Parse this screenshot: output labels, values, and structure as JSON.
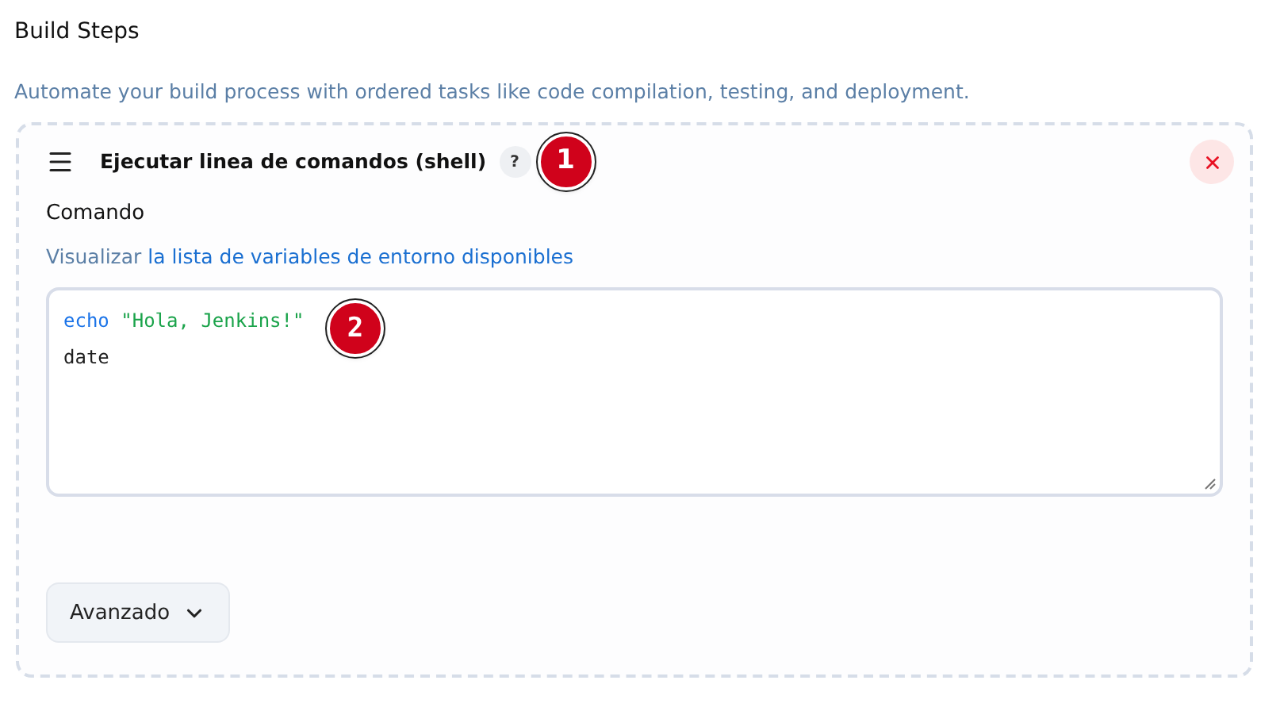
{
  "section": {
    "title": "Build Steps",
    "description": "Automate your build process with ordered tasks like code compilation, testing, and deployment."
  },
  "step": {
    "title": "Ejecutar linea de comandos (shell)",
    "help": "?",
    "field_label": "Comando",
    "link_prefix": "Visualizar",
    "link": "la lista de variables de entorno disponibles",
    "code_lines": [
      [
        {
          "kind": "keyword",
          "text": "echo"
        },
        {
          "kind": "string",
          "text": "\"Hola, Jenkins!\""
        }
      ],
      [
        {
          "kind": "plain",
          "text": "date"
        }
      ]
    ],
    "advanced_button": "Avanzado"
  },
  "callouts": [
    "1",
    "2"
  ]
}
